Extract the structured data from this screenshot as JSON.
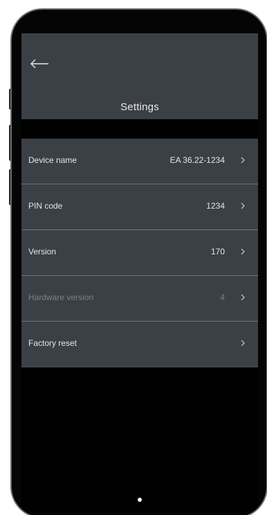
{
  "header": {
    "title": "Settings",
    "back_icon": "arrow-left-icon"
  },
  "settings": {
    "items": [
      {
        "label": "Device name",
        "value": "EA 36.22-1234",
        "enabled": true
      },
      {
        "label": "PIN code",
        "value": "1234",
        "enabled": true
      },
      {
        "label": "Version",
        "value": "170",
        "enabled": true
      },
      {
        "label": "Hardware version",
        "value": "4",
        "enabled": false
      },
      {
        "label": "Factory reset",
        "value": "",
        "enabled": true
      }
    ],
    "chevron_icon": "chevron-right-icon"
  },
  "colors": {
    "panel": "#3b3f46",
    "background": "#000000",
    "text": "#e6e6e8",
    "disabled_text": "#7c8087"
  }
}
